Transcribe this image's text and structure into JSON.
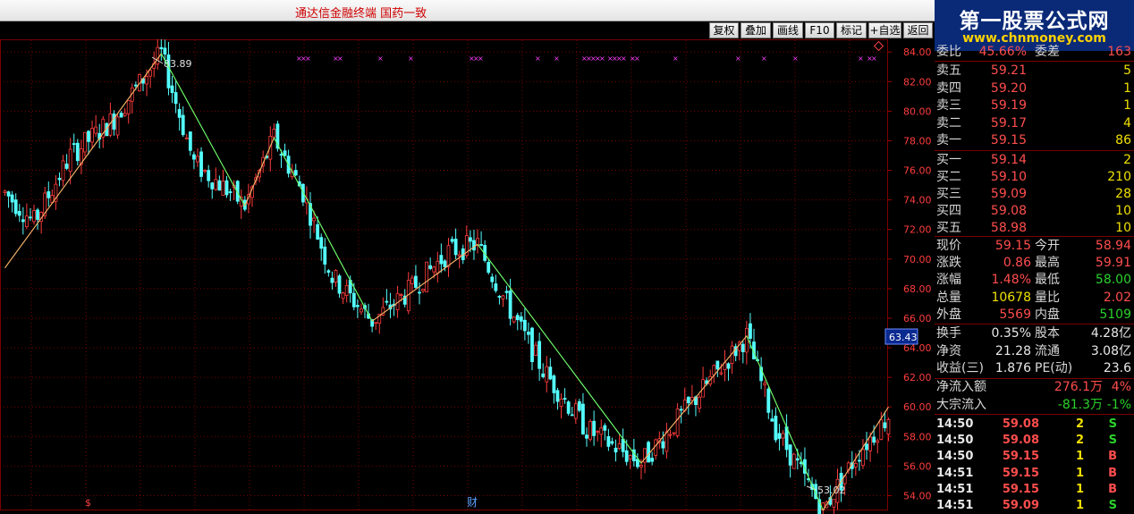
{
  "app": {
    "title": "通达信金融终端    国药一致"
  },
  "logo": {
    "title": "第一股票公式网",
    "url": "www.chnmoney.com"
  },
  "toolbar": {
    "buttons": [
      "复权",
      "叠加",
      "画线",
      "F10",
      "标记",
      "+自选",
      "返回"
    ]
  },
  "chart": {
    "y_ticks": [
      "84.00",
      "82.00",
      "80.00",
      "78.00",
      "76.00",
      "74.00",
      "72.00",
      "70.00",
      "68.00",
      "66.00",
      "64.00",
      "62.00",
      "60.00",
      "58.00",
      "56.00",
      "54.00"
    ],
    "current_price_tag": "63.43",
    "annotation_high": "83.89",
    "annotation_low": "53.02",
    "marker_left": "$",
    "marker_cai": "财",
    "colors": {
      "up": "#ff3c3c",
      "down": "#54ffff",
      "grid": "#7a0000",
      "zigzag_down": "#66ff66",
      "zigzag_up": "#ffaa66"
    }
  },
  "chart_data": {
    "type": "candlestick",
    "ylim": [
      53,
      84.8
    ],
    "zigzag_points": [
      [
        -1,
        69.4
      ],
      [
        43,
        83.89
      ],
      [
        74,
        78.2
      ],
      [
        66,
        73.6
      ],
      [
        101,
        65.8
      ],
      [
        130,
        71.0
      ],
      [
        175,
        56.2
      ],
      [
        204,
        64.8
      ],
      [
        225,
        53.02
      ],
      [
        243,
        60.0
      ]
    ],
    "extremes": {
      "high": 83.89,
      "low": 53.02
    }
  },
  "orderbook": {
    "header_label": "委比",
    "header_value": "45.66%",
    "header_label2": "委差",
    "header_value2": "163",
    "asks": [
      {
        "label": "卖五",
        "price": "59.21",
        "vol": "5"
      },
      {
        "label": "卖四",
        "price": "59.20",
        "vol": "1"
      },
      {
        "label": "卖三",
        "price": "59.19",
        "vol": "1"
      },
      {
        "label": "卖二",
        "price": "59.17",
        "vol": "4"
      },
      {
        "label": "卖一",
        "price": "59.15",
        "vol": "86"
      }
    ],
    "bids": [
      {
        "label": "买一",
        "price": "59.14",
        "vol": "2"
      },
      {
        "label": "买二",
        "price": "59.10",
        "vol": "210"
      },
      {
        "label": "买三",
        "price": "59.09",
        "vol": "28"
      },
      {
        "label": "买四",
        "price": "59.08",
        "vol": "10"
      },
      {
        "label": "买五",
        "price": "58.98",
        "vol": "10"
      }
    ]
  },
  "quote": [
    {
      "l1": "现价",
      "v1": "59.15",
      "c1": "red",
      "l2": "今开",
      "v2": "58.94",
      "c2": "red"
    },
    {
      "l1": "涨跌",
      "v1": "0.86",
      "c1": "red",
      "l2": "最高",
      "v2": "59.91",
      "c2": "red"
    },
    {
      "l1": "涨幅",
      "v1": "1.48%",
      "c1": "red",
      "l2": "最低",
      "v2": "58.00",
      "c2": "grn"
    },
    {
      "l1": "总量",
      "v1": "10678",
      "c1": "ylw",
      "l2": "量比",
      "v2": "2.02",
      "c2": "red"
    },
    {
      "l1": "外盘",
      "v1": "5569",
      "c1": "red",
      "l2": "内盘",
      "v2": "5109",
      "c2": "grn"
    }
  ],
  "fundamentals": [
    {
      "l1": "换手",
      "v1": "0.35%",
      "l2": "股本",
      "v2": "4.28亿"
    },
    {
      "l1": "净资",
      "v1": "21.28",
      "l2": "流通",
      "v2": "3.08亿"
    },
    {
      "l1": "收益(三)",
      "v1": "1.876",
      "l2": "PE(动)",
      "v2": "23.6"
    }
  ],
  "flows": [
    {
      "label": "净流入额",
      "value": "276.1万",
      "pct": "4%",
      "color": "red"
    },
    {
      "label": "大宗流入",
      "value": "-81.3万",
      "pct": "-1%",
      "color": "grn"
    }
  ],
  "trades": [
    {
      "time": "14:50",
      "price": "59.08",
      "vol": "2",
      "side": "S"
    },
    {
      "time": "14:50",
      "price": "59.08",
      "vol": "2",
      "side": "S"
    },
    {
      "time": "14:50",
      "price": "59.15",
      "vol": "1",
      "side": "B"
    },
    {
      "time": "14:51",
      "price": "59.15",
      "vol": "1",
      "side": "B"
    },
    {
      "time": "14:51",
      "price": "59.15",
      "vol": "1",
      "side": "B"
    },
    {
      "time": "14:51",
      "price": "59.09",
      "vol": "1",
      "side": "S"
    }
  ]
}
